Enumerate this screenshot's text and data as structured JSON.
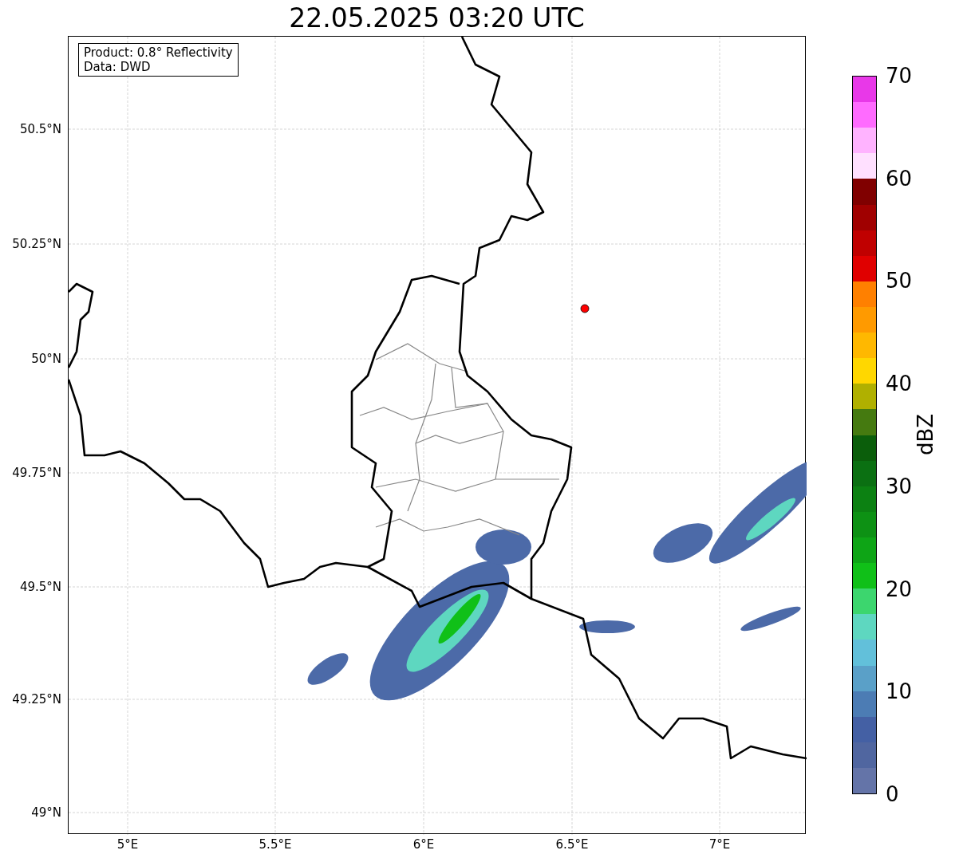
{
  "title": "22.05.2025 03:20 UTC",
  "annotation": [
    "Product: 0.8° Reflectivity",
    "Data: DWD"
  ],
  "y_ticks": [
    "50.5°N",
    "50.25°N",
    "50°N",
    "49.75°N",
    "49.5°N",
    "49.25°N",
    "49°N"
  ],
  "x_ticks": [
    "5°E",
    "5.5°E",
    "6°E",
    "6.5°E",
    "7°E"
  ],
  "colorbar": {
    "label": "dBZ",
    "ticks": [
      "70",
      "60",
      "50",
      "40",
      "30",
      "20",
      "10",
      "0"
    ],
    "bins": [
      {
        "color": "#e838e8"
      },
      {
        "color": "#ff6bff"
      },
      {
        "color": "#ffb3ff"
      },
      {
        "color": "#ffe0ff"
      },
      {
        "color": "#800000"
      },
      {
        "color": "#a00000"
      },
      {
        "color": "#c00000"
      },
      {
        "color": "#e00000"
      },
      {
        "color": "#ff8000"
      },
      {
        "color": "#ff9a00"
      },
      {
        "color": "#ffb800"
      },
      {
        "color": "#ffd700"
      },
      {
        "color": "#b0b000"
      },
      {
        "color": "#457a10"
      },
      {
        "color": "#0b5e0b"
      },
      {
        "color": "#0b7012"
      },
      {
        "color": "#0c8112"
      },
      {
        "color": "#0d9114"
      },
      {
        "color": "#0ea516"
      },
      {
        "color": "#10c018"
      },
      {
        "color": "#3cd66e"
      },
      {
        "color": "#5ed7c0"
      },
      {
        "color": "#62c0da"
      },
      {
        "color": "#5aa0c8"
      },
      {
        "color": "#4c7cb4"
      },
      {
        "color": "#4460a4"
      },
      {
        "color": "#5066a0"
      },
      {
        "color": "#6474a8"
      }
    ]
  }
}
